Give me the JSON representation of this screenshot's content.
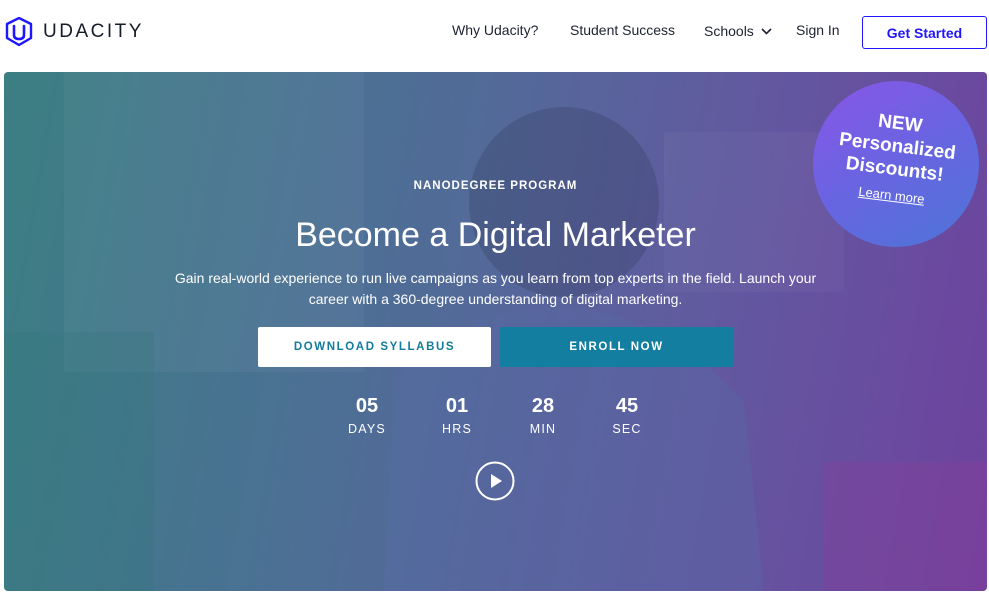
{
  "header": {
    "logo_text": "UDACITY",
    "nav": {
      "why": "Why Udacity?",
      "success": "Student Success",
      "schools": "Schools",
      "signin": "Sign In"
    },
    "cta": "Get Started"
  },
  "hero": {
    "eyebrow": "NANODEGREE PROGRAM",
    "title": "Become a Digital Marketer",
    "subtitle": "Gain real-world experience to run live campaigns as you learn from top experts in the field. Launch your career with a 360-degree understanding of digital marketing.",
    "download_label": "DOWNLOAD SYLLABUS",
    "enroll_label": "ENROLL NOW",
    "countdown": [
      {
        "value": "05",
        "unit": "DAYS"
      },
      {
        "value": "01",
        "unit": "HRS"
      },
      {
        "value": "28",
        "unit": "MIN"
      },
      {
        "value": "45",
        "unit": "SEC"
      }
    ]
  },
  "badge": {
    "new": "NEW",
    "line1": "Personalized",
    "line2": "Discounts!",
    "link": "Learn more"
  },
  "icons": {
    "logo": "udacity-logo-icon",
    "schools_dropdown": "chevron-down-icon",
    "play": "play-icon"
  },
  "colors": {
    "brand_blue": "#2015ff",
    "enroll_teal": "#137e9f",
    "badge_purple": "#8a56e6"
  }
}
